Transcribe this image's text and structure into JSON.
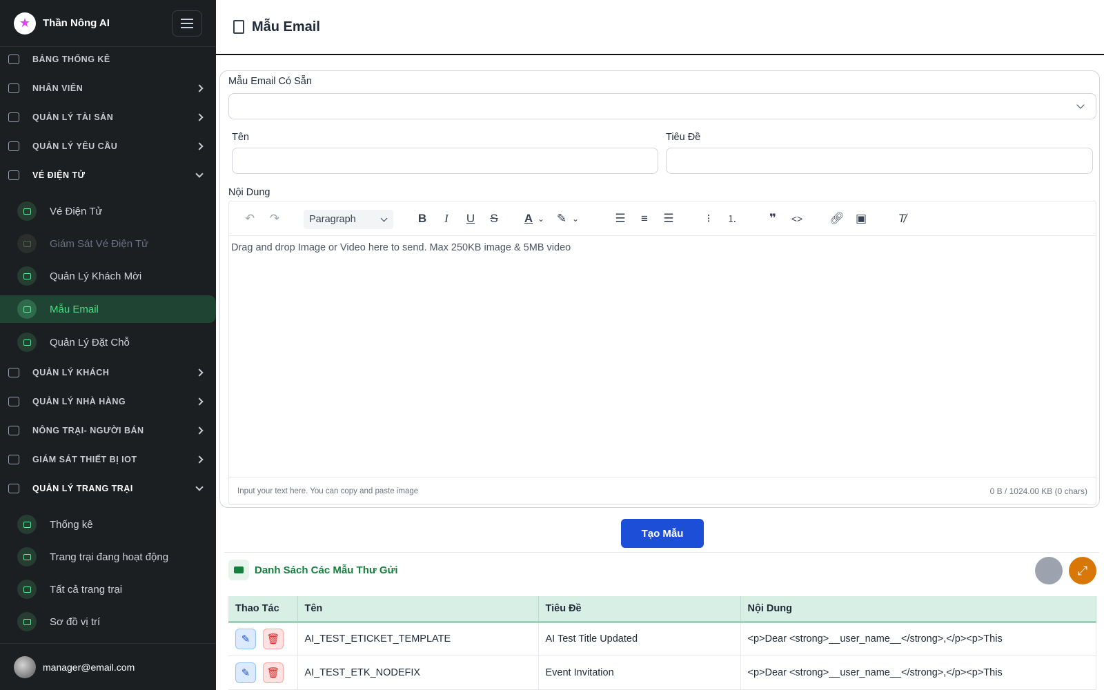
{
  "app": {
    "brand": "Thần Nông AI",
    "user_email": "manager@email.com"
  },
  "sidebar": {
    "sections": [
      {
        "label": "BẢNG THỐNG KÊ"
      },
      {
        "label": "NHÂN VIÊN"
      },
      {
        "label": "QUẢN LÝ TÀI SẢN"
      },
      {
        "label": "QUẢN LÝ YÊU CẦU"
      },
      {
        "label": "VÉ ĐIỆN TỬ"
      },
      {
        "label": "QUẢN LÝ KHÁCH"
      },
      {
        "label": "QUẢN LÝ NHÀ HÀNG"
      },
      {
        "label": "NÔNG TRẠI- NGƯỜI BÁN"
      },
      {
        "label": "GIÁM SÁT THIẾT BỊ IOT"
      },
      {
        "label": "QUẢN LÝ TRANG TRẠI"
      }
    ],
    "ticket_items": [
      {
        "label": "Vé Điện Tử"
      },
      {
        "label": "Giám Sát Vé Điện Tử"
      },
      {
        "label": "Quản Lý Khách Mời"
      },
      {
        "label": "Mẫu Email"
      },
      {
        "label": "Quản Lý Đặt Chỗ"
      }
    ],
    "farm_items": [
      {
        "label": "Thống kê"
      },
      {
        "label": "Trang trại đang hoạt động"
      },
      {
        "label": "Tất cả trang trại"
      },
      {
        "label": "Sơ đồ vị trí"
      }
    ]
  },
  "page": {
    "title": "Mẫu Email"
  },
  "form": {
    "template_select_label": "Mẫu Email Có Sẵn",
    "template_select_value": "",
    "name_label": "Tên",
    "name_value": "",
    "subject_label": "Tiêu Đề",
    "subject_value": "",
    "content_label": "Nội Dung",
    "block_style": "Paragraph",
    "editor_hint": "Drag and drop Image or Video here to send. Max 250KB image & 5MB video",
    "footer_hint": "Input your text here. You can copy and paste image",
    "size_info": "0 B / 1024.00 KB (0 chars)",
    "create_button": "Tạo Mẫu"
  },
  "list": {
    "title": "Danh Sách Các Mẫu Thư Gửi",
    "columns": [
      "Thao Tác",
      "Tên",
      "Tiêu Đề",
      "Nội Dung"
    ],
    "rows": [
      {
        "name": "AI_TEST_ETICKET_TEMPLATE",
        "subject": "AI Test Title Updated",
        "content": "<p>Dear <strong>__user_name__</strong>,</p><p>This"
      },
      {
        "name": "AI_TEST_ETK_NODEFIX",
        "subject": "Event Invitation",
        "content": "<p>Dear <strong>__user_name__</strong>,</p><p>This"
      }
    ]
  },
  "colors": {
    "sidebar_bg": "#1c1f22",
    "accent_green": "#15803d",
    "primary_blue": "#1d4ed8"
  }
}
